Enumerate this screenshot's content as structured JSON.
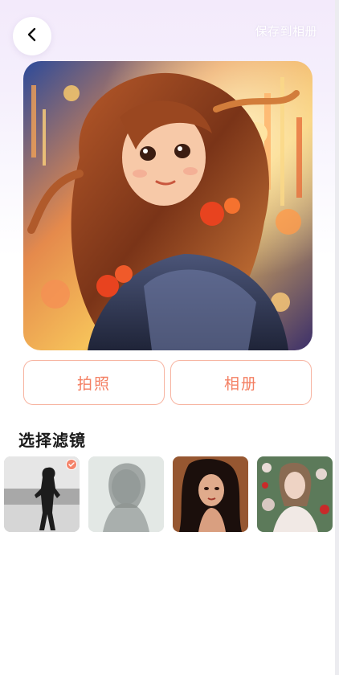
{
  "header": {
    "back_icon": "chevron-left-icon",
    "save_label": "保存到相册"
  },
  "preview": {
    "description_icon": "anime-girl-portrait-image"
  },
  "actions": {
    "photo_label": "拍照",
    "album_label": "相册"
  },
  "filters": {
    "title": "选择滤镜",
    "items": [
      {
        "id": "filter-bw",
        "selected": true
      },
      {
        "id": "filter-faded",
        "selected": false
      },
      {
        "id": "filter-warm",
        "selected": false
      },
      {
        "id": "filter-floral",
        "selected": false
      }
    ]
  },
  "colors": {
    "accent": "#f47f62",
    "accent_border": "#f7b3a0",
    "bg_top": "#f3eafb"
  }
}
